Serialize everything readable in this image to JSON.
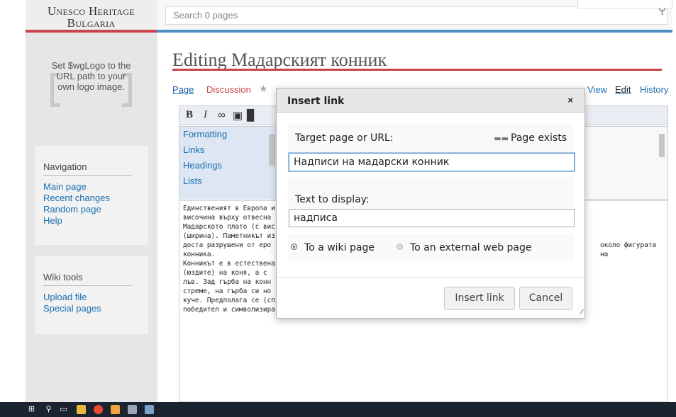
{
  "site": {
    "title_line1": "Unesco Heritage",
    "title_line2": "Bulgaria",
    "logo_text": "Set $wgLogo to the URL path to your own logo image."
  },
  "search": {
    "placeholder": "Search 0 pages"
  },
  "navigation": {
    "heading": "Navigation",
    "items": [
      "Main page",
      "Recent changes",
      "Random page",
      "Help"
    ]
  },
  "wiki_tools": {
    "heading": "Wiki tools",
    "items": [
      "Upload file",
      "Special pages"
    ]
  },
  "page": {
    "title": "Editing Мадарският конник",
    "tabs": {
      "page": "Page",
      "discussion": "Discussion",
      "view": "View",
      "edit": "Edit",
      "history": "History"
    }
  },
  "editor": {
    "toolbar": {
      "bold": "B",
      "italic": "I"
    },
    "special_list": [
      "Formatting",
      "Links",
      "Headings",
      "Lists"
    ],
    "wikitext_lines": [
      "Единственият в Европа и",
      "височина върху отвесна ",
      "Мадарското плато (с вис",
      "(ширина). Паметникът из",
      "доста разрушени от еро",
      "конника.",
      "Конникът е в естествена",
      "(юздите) на коня, а с ",
      "лъв. Зад гърба на конн",
      "стреме, на гърба си но",
      "куче. Предполага се (сп",
      "победител и символизира величието на българския владетел и мощта на българската държава."
    ],
    "wikitext_right_fragment": "около фигурата на"
  },
  "dialog": {
    "title": "Insert link",
    "close": "×",
    "target_label": "Target page or URL:",
    "page_exists": "Page exists",
    "target_value": "Надписи на мадарски конник",
    "text_label": "Text to display:",
    "text_value": "надписа",
    "radio_wiki": "To a wiki page",
    "radio_external": "To an external web page",
    "insert_button": "Insert link",
    "cancel_button": "Cancel",
    "selected_radio": "To a wiki page"
  },
  "colors": {
    "accent_red": "#c9444a",
    "accent_blue": "#4b8fc8",
    "link": "#1a6fb0"
  }
}
